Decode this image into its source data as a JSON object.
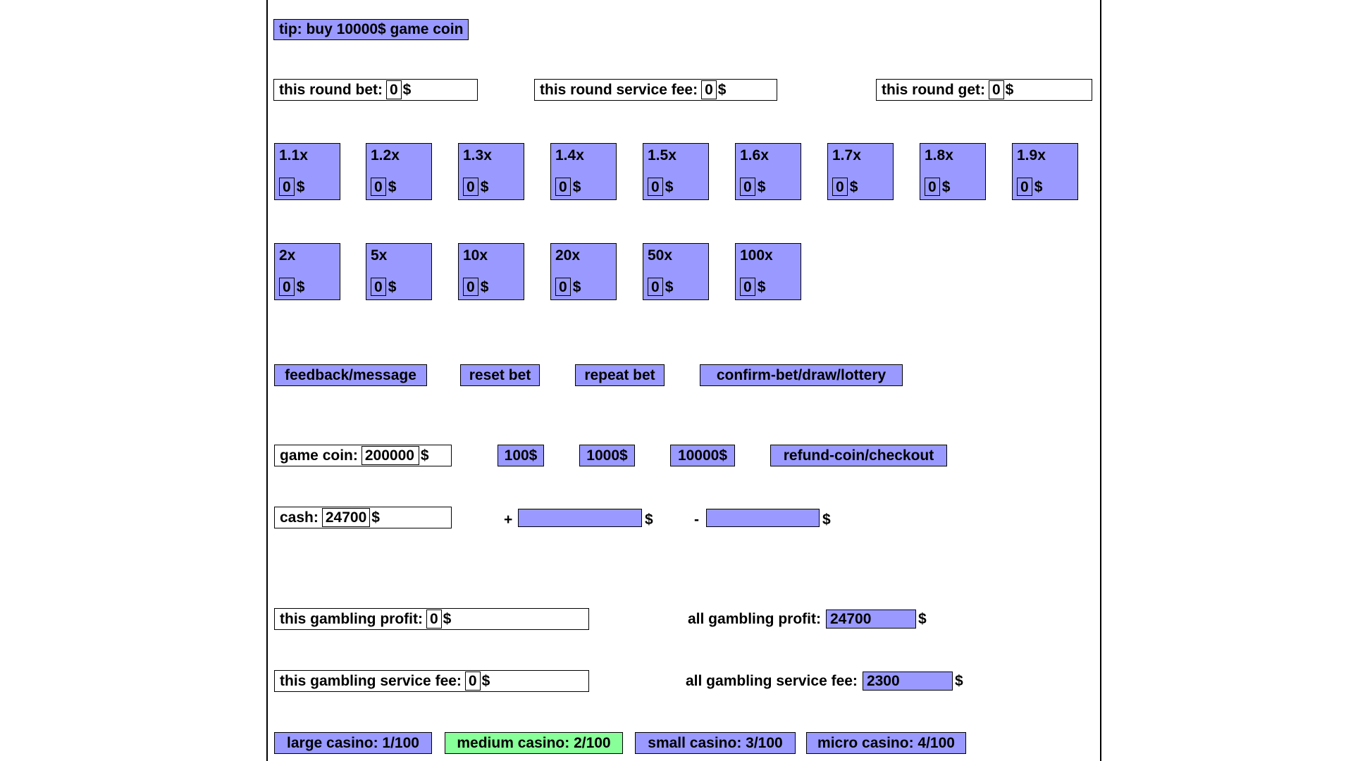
{
  "tip": {
    "text": "tip: buy 10000$ game coin"
  },
  "round_row": {
    "bet": {
      "label": "this round bet:",
      "value": "0",
      "currency": "$"
    },
    "service_fee": {
      "label": "this round service fee:",
      "value": "0",
      "currency": "$"
    },
    "get": {
      "label": "this round get:",
      "value": "0",
      "currency": "$"
    }
  },
  "multipliers_row1": [
    {
      "label": "1.1x",
      "stake": "0",
      "currency": "$"
    },
    {
      "label": "1.2x",
      "stake": "0",
      "currency": "$"
    },
    {
      "label": "1.3x",
      "stake": "0",
      "currency": "$"
    },
    {
      "label": "1.4x",
      "stake": "0",
      "currency": "$"
    },
    {
      "label": "1.5x",
      "stake": "0",
      "currency": "$"
    },
    {
      "label": "1.6x",
      "stake": "0",
      "currency": "$"
    },
    {
      "label": "1.7x",
      "stake": "0",
      "currency": "$"
    },
    {
      "label": "1.8x",
      "stake": "0",
      "currency": "$"
    },
    {
      "label": "1.9x",
      "stake": "0",
      "currency": "$"
    }
  ],
  "multipliers_row2": [
    {
      "label": "2x",
      "stake": "0",
      "currency": "$"
    },
    {
      "label": "5x",
      "stake": "0",
      "currency": "$"
    },
    {
      "label": "10x",
      "stake": "0",
      "currency": "$"
    },
    {
      "label": "20x",
      "stake": "0",
      "currency": "$"
    },
    {
      "label": "50x",
      "stake": "0",
      "currency": "$"
    },
    {
      "label": "100x",
      "stake": "0",
      "currency": "$"
    }
  ],
  "actions": {
    "feedback": "feedback/message",
    "reset_bet": "reset bet",
    "repeat_bet": "repeat bet",
    "confirm": "confirm-bet/draw/lottery"
  },
  "coin_row": {
    "game_coin": {
      "label": "game coin:",
      "value": "200000",
      "currency": "$"
    },
    "buy_100": "100$",
    "buy_1000": "1000$",
    "buy_10000": "10000$",
    "refund": "refund-coin/checkout"
  },
  "cash_row": {
    "cash": {
      "label": "cash:",
      "value": "24700",
      "currency": "$"
    },
    "plus_sign": "+",
    "plus_value": "",
    "plus_currency": "$",
    "minus_sign": "-",
    "minus_value": "",
    "minus_currency": "$"
  },
  "profit_row": {
    "this_profit": {
      "label": "this gambling profit:",
      "value": "0",
      "currency": "$"
    },
    "all_profit": {
      "label": "all gambling profit:",
      "value": "24700",
      "currency": "$"
    }
  },
  "fee_row": {
    "this_fee": {
      "label": "this gambling service fee:",
      "value": "0",
      "currency": "$"
    },
    "all_fee": {
      "label": "all gambling service fee:",
      "value": "2300",
      "currency": "$"
    }
  },
  "casinos": [
    {
      "label": "large casino: 1/100",
      "selected": false
    },
    {
      "label": "medium casino: 2/100",
      "selected": true
    },
    {
      "label": "small casino: 3/100",
      "selected": false
    },
    {
      "label": "micro casino: 4/100",
      "selected": false
    }
  ],
  "colors": {
    "accent": "#9999ff",
    "selected": "#88ff99",
    "border": "#000000",
    "background": "#ffffff"
  }
}
